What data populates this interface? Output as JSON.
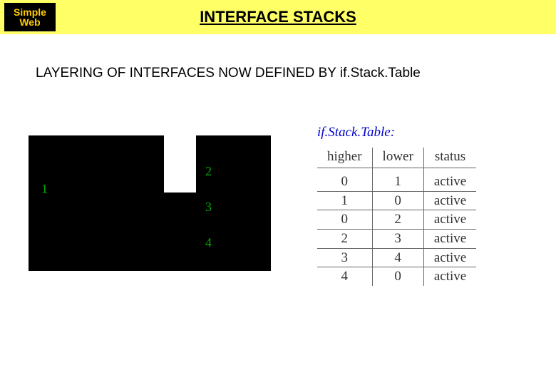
{
  "header": {
    "logo_line1": "Simple",
    "logo_line2": "Web",
    "title": "INTERFACE STACKS"
  },
  "subtitle": "LAYERING OF INTERFACES NOW DEFINED BY if.Stack.Table",
  "diagram": {
    "labels": {
      "n1": "1",
      "n2": "2",
      "n3": "3",
      "n4": "4"
    }
  },
  "table": {
    "caption": "if.Stack.Table:",
    "columns": {
      "higher": "higher",
      "lower": "lower",
      "status": "status"
    },
    "rows": [
      {
        "higher": "0",
        "lower": "1",
        "status": "active"
      },
      {
        "higher": "1",
        "lower": "0",
        "status": "active"
      },
      {
        "higher": "0",
        "lower": "2",
        "status": "active"
      },
      {
        "higher": "2",
        "lower": "3",
        "status": "active"
      },
      {
        "higher": "3",
        "lower": "4",
        "status": "active"
      },
      {
        "higher": "4",
        "lower": "0",
        "status": "active"
      }
    ]
  }
}
